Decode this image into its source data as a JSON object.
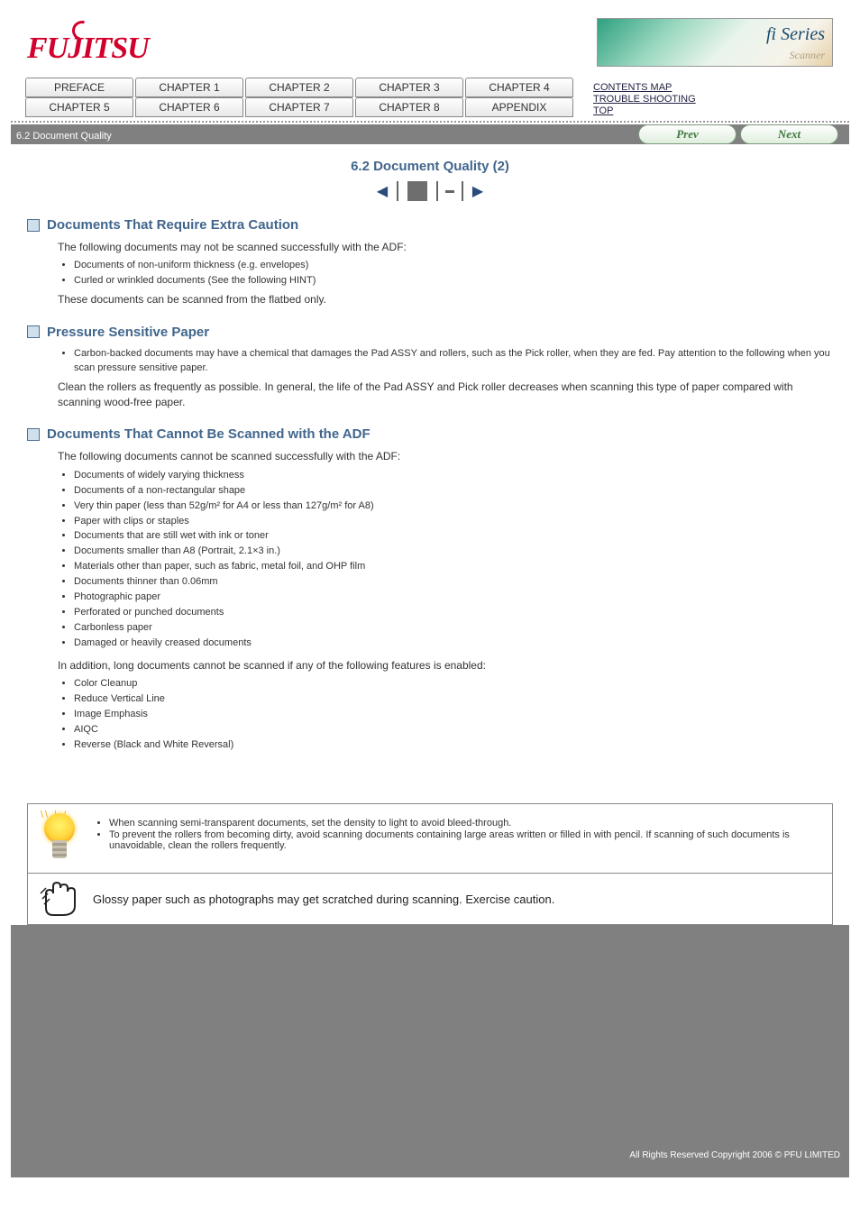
{
  "header": {
    "logo_text": "FUJITSU",
    "banner_title": "fi Series",
    "banner_sub": "Scanner"
  },
  "tabs": {
    "row1": [
      "PREFACE",
      "CHAPTER 1",
      "CHAPTER 2",
      "CHAPTER 3",
      "CHAPTER 4"
    ],
    "row2": [
      "CHAPTER 5",
      "CHAPTER 6",
      "CHAPTER 7",
      "CHAPTER 8",
      "APPENDIX"
    ]
  },
  "side_links": {
    "top": "CONTENTS MAP",
    "mid": "TROUBLE SHOOTING",
    "bot": "TOP"
  },
  "graybar": {
    "breadcrumb": "6.2 Document Quality"
  },
  "nav": {
    "prev": "Prev",
    "next": "Next"
  },
  "page_title": "6.2 Document Quality (2)",
  "sections": {
    "s1": {
      "title": "Documents That Require Extra Caution",
      "intro": "The following documents may not be scanned successfully with the ADF:",
      "items": [
        "Documents of non-uniform thickness (e.g. envelopes)",
        "Curled or wrinkled documents (See the following HINT)"
      ],
      "outro": "These documents can be scanned from the flatbed only."
    },
    "s2": {
      "title": "Pressure Sensitive Paper",
      "items": [
        "Carbon-backed documents may have a chemical that damages the Pad ASSY and rollers, such as the Pick roller, when they are fed. Pay attention to the following when you scan pressure sensitive paper."
      ],
      "outro": "Clean the rollers as frequently as possible. In general, the life of the Pad ASSY and Pick roller decreases when scanning this type of paper compared with scanning wood-free paper."
    },
    "s3": {
      "title": "Documents That Cannot Be Scanned with the ADF",
      "intro": "The following documents cannot be scanned successfully with the ADF:",
      "items": [
        "Documents of widely varying thickness",
        "Documents of a non-rectangular shape",
        "Very thin paper (less than 52g/m² for A4 or less than 127g/m² for A8)",
        "Paper with clips or staples",
        "Documents that are still wet with ink or toner",
        "Documents smaller than A8 (Portrait, 2.1×3 in.)",
        "Materials other than paper, such as fabric, metal foil, and OHP film",
        "Documents thinner than 0.06mm",
        "Photographic paper",
        "Perforated or punched documents",
        "Carbonless paper",
        "Damaged or heavily creased documents"
      ],
      "mid": "In addition, long documents cannot be scanned if any of the following features is enabled:",
      "items2": [
        "Color Cleanup",
        "Reduce Vertical Line",
        "Image Emphasis",
        "AIQC",
        "Reverse (Black and White Reversal)"
      ]
    }
  },
  "hint": {
    "items": [
      "When scanning semi-transparent documents, set the density to light to avoid bleed-through.",
      "To prevent the rollers from becoming dirty, avoid scanning documents containing large areas written or filled in with pencil. If scanning of such documents is unavoidable, clean the rollers frequently."
    ]
  },
  "attention": {
    "text": "Glossy paper such as photographs may get scratched during scanning. Exercise caution."
  },
  "footer_note": "All Rights Reserved Copyright 2006 © PFU LIMITED"
}
